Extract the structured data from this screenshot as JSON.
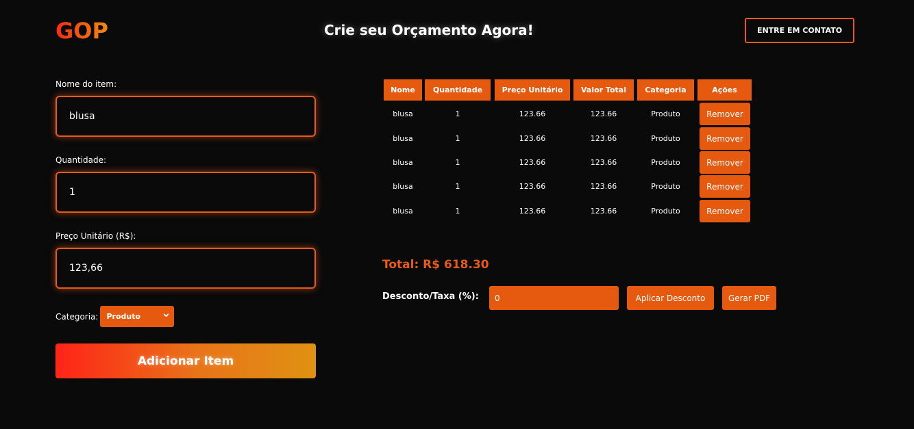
{
  "header": {
    "logo": "GOP",
    "headline": "Crie seu Orçamento Agora!",
    "contact_label": "ENTRE EM CONTATO"
  },
  "form": {
    "name_label": "Nome do item:",
    "name_value": "blusa",
    "qty_label": "Quantidade:",
    "qty_value": "1",
    "price_label": "Preço Unitário (R$):",
    "price_value": "123,66",
    "category_label": "Categoria:",
    "category_value": "Produto",
    "add_label": "Adicionar Item"
  },
  "table": {
    "headers": [
      "Nome",
      "Quantidade",
      "Preço Unitário",
      "Valor Total",
      "Categoria",
      "Ações"
    ],
    "remove_label": "Remover",
    "rows": [
      [
        "blusa",
        "1",
        "123.66",
        "123.66",
        "Produto"
      ],
      [
        "blusa",
        "1",
        "123.66",
        "123.66",
        "Produto"
      ],
      [
        "blusa",
        "1",
        "123.66",
        "123.66",
        "Produto"
      ],
      [
        "blusa",
        "1",
        "123.66",
        "123.66",
        "Produto"
      ],
      [
        "blusa",
        "1",
        "123.66",
        "123.66",
        "Produto"
      ]
    ]
  },
  "summary": {
    "total": "Total: R$ 618.30",
    "discount_label": "Desconto/Taxa (%):",
    "discount_value": "0",
    "apply_label": "Aplicar Desconto",
    "pdf_label": "Gerar PDF"
  },
  "colors": {
    "accent": "#e65a10",
    "background": "#0a0a0a",
    "text": "#ffffff"
  }
}
